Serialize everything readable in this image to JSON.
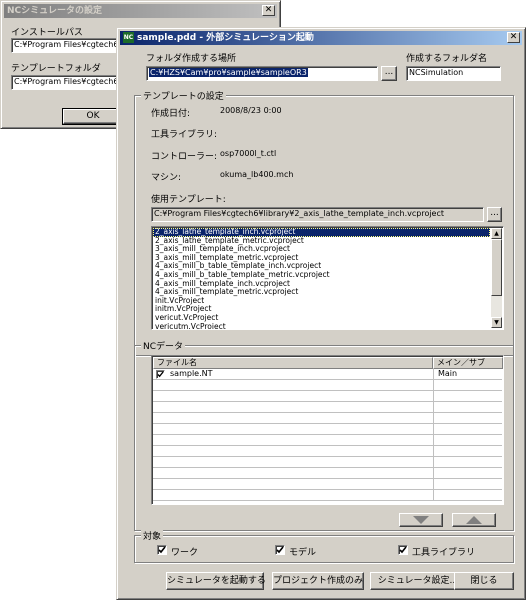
{
  "bg_window": {
    "title": "NCシミュレータの設定",
    "install_path_label": "インストールパス",
    "install_path_value": "C:¥Program Files¥cgtech6¥windows",
    "template_folder_label": "テンプレートフォルダ",
    "template_folder_value": "C:¥Program Files¥cgtech6¥library",
    "ok_label": "OK"
  },
  "main_window": {
    "title": "sample.pdd - 外部シミュレーション起動",
    "icon_text": "NC",
    "folder_location_label": "フォルダ作成する場所",
    "folder_location_value": "C:¥HZS¥Cam¥pro¥sample¥sampleOR3",
    "browse_label": "...",
    "folder_name_label": "作成するフォルダ名",
    "folder_name_value": "NCSimulation"
  },
  "template_settings": {
    "group_title": "テンプレートの設定",
    "date_label": "作成日付:",
    "date_value": "2008/8/23 0:00",
    "tool_library_label": "工具ライブラリ:",
    "tool_library_value": "",
    "controller_label": "コントローラー:",
    "controller_value": "osp7000l_t.ctl",
    "machine_label": "マシン:",
    "machine_value": "okuma_lb400.mch",
    "used_template_label": "使用テンプレート:",
    "used_template_value": "C:¥Program Files¥cgtech6¥library¥2_axis_lathe_template_inch.vcproject",
    "template_list": [
      "2_axis_lathe_template_inch.vcproject",
      "2_axis_lathe_template_metric.vcproject",
      "3_axis_mill_template_inch.vcproject",
      "3_axis_mill_template_metric.vcproject",
      "4_axis_mill_b_table_template_inch.vcproject",
      "4_axis_mill_b_table_template_metric.vcproject",
      "4_axis_mill_template_inch.vcproject",
      "4_axis_mill_template_metric.vcproject",
      "init.VcProject",
      "initm.VcProject",
      "vericut.VcProject",
      "vericutm.VcProject"
    ],
    "selected_index": 0
  },
  "nc_data": {
    "group_title": "NCデータ",
    "col_filename": "ファイル名",
    "col_main_sub": "メイン／サブ",
    "rows": [
      {
        "filename": "sample.NT",
        "type": "Main",
        "checked": true
      }
    ]
  },
  "target": {
    "group_title": "対象",
    "work_label": "ワーク",
    "model_label": "モデル",
    "tool_library_label": "工具ライブラリ"
  },
  "buttons": {
    "launch_simulator": "シミュレータを起動する",
    "create_project_only": "プロジェクト作成のみ",
    "simulator_settings": "シミュレータ設定..",
    "close": "閉じる"
  }
}
